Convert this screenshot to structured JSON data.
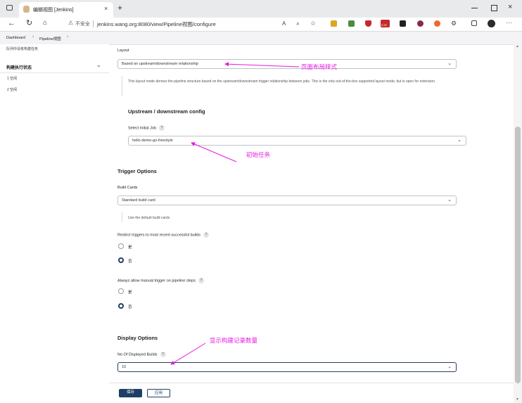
{
  "browser": {
    "tab_title": "编辑视图 [Jenkins]",
    "new_tab_symbol": "+",
    "insecure_label": "不安全",
    "url": "jenkins.wang.org:8080/view/Pipeline视图/configure",
    "ext_badge": "0.00"
  },
  "breadcrumb": {
    "items": [
      "Dashboard",
      "Pipeline视图"
    ]
  },
  "sidebar": {
    "queue_text": "队列中没有构建任务",
    "executor_title": "构建执行状态",
    "executors": [
      "1 空闲",
      "2 空闲"
    ]
  },
  "form": {
    "layout_label": "Layout",
    "layout_value": "Based on upstream/downstream relationship",
    "layout_desc": "This layout mode derives the pipeline structure based on the upstream/downstream trigger relationship between jobs. This is the only out-of-the-box supported layout mode, but is open for extension.",
    "upstream_title": "Upstream / downstream config",
    "initial_job_label": "Select Initial Job",
    "initial_job_value": "hello-demo-go-freestyle",
    "trigger_title": "Trigger Options",
    "build_cards_label": "Build Cards",
    "build_cards_value": "Standard build card",
    "build_cards_desc": "Use the default build cards",
    "restrict_label": "Restrict triggers to most recent successful builds",
    "yes": "是",
    "no": "否",
    "manual_label": "Always allow manual trigger on pipeline steps",
    "display_title": "Display Options",
    "displayed_builds_label": "No Of Displayed Builds",
    "displayed_builds_value": "10",
    "help_symbol": "?"
  },
  "buttons": {
    "save": "保存",
    "apply": "应用"
  },
  "annotations": {
    "layout_note": "页面布局样式",
    "initial_job_note": "初始任务",
    "builds_note": "显示构建记录数量",
    "color": "#e51ae0"
  }
}
